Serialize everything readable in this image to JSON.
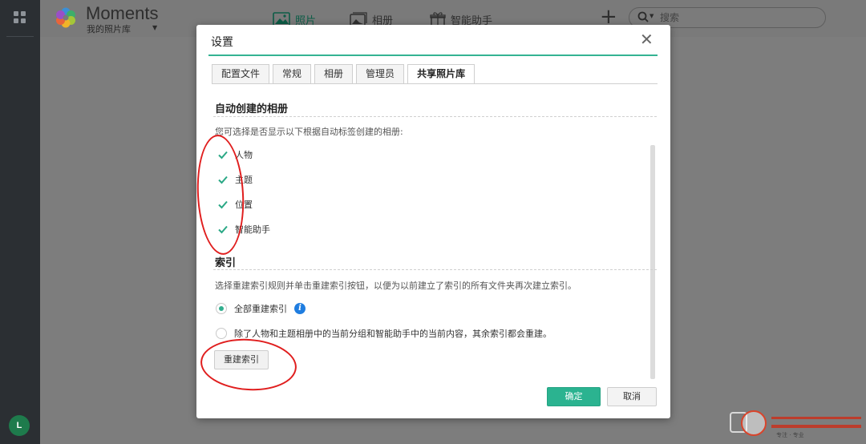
{
  "app": {
    "title": "Moments",
    "library": "我的照片库"
  },
  "nav": {
    "photos": "照片",
    "albums": "相册",
    "assistant": "智能助手"
  },
  "search": {
    "placeholder": "搜索"
  },
  "user": {
    "avatar_letter": "L"
  },
  "dialog": {
    "title": "设置",
    "tabs": [
      {
        "label": "配置文件",
        "active": false
      },
      {
        "label": "常规",
        "active": false
      },
      {
        "label": "相册",
        "active": false
      },
      {
        "label": "管理员",
        "active": false
      },
      {
        "label": "共享照片库",
        "active": true
      }
    ],
    "auto_albums": {
      "heading": "自动创建的相册",
      "description": "您可选择是否显示以下根据自动标签创建的相册:",
      "items": [
        {
          "label": "人物",
          "checked": true
        },
        {
          "label": "主题",
          "checked": true
        },
        {
          "label": "位置",
          "checked": true
        },
        {
          "label": "智能助手",
          "checked": true
        }
      ]
    },
    "index": {
      "heading": "索引",
      "description": "选择重建索引规则并单击重建索引按钮，以便为以前建立了索引的所有文件夹再次建立索引。",
      "options": [
        {
          "label": "全部重建索引",
          "selected": true
        },
        {
          "label": "除了人物和主题相册中的当前分组和智能助手中的当前内容，其余索引都会重建。",
          "selected": false
        }
      ],
      "rebuild_button": "重建索引"
    },
    "ok_button": "确定",
    "cancel_button": "取消"
  },
  "watermark": {
    "text": "专注 · 专业"
  },
  "colors": {
    "accent": "#2bb390",
    "annotation": "#e01e1e",
    "rail": "#2b2f33",
    "overlay": "#7d7d7d"
  }
}
